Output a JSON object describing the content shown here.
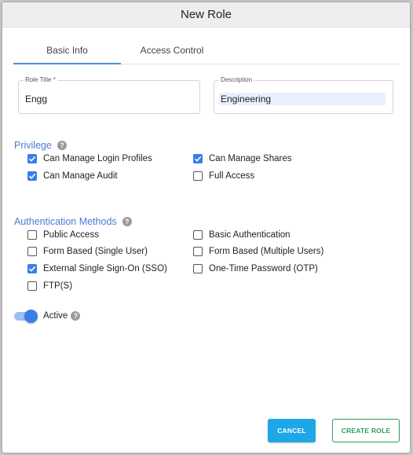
{
  "dialog": {
    "title": "New Role"
  },
  "tabs": [
    {
      "label": "Basic Info",
      "active": true
    },
    {
      "label": "Access Control",
      "active": false
    }
  ],
  "fields": {
    "role_title": {
      "label": "Role Title *",
      "value": "Engg"
    },
    "description": {
      "label": "Description",
      "value": "Engineering"
    }
  },
  "privilege": {
    "title": "Privilege",
    "help_icon": "help-icon",
    "items": [
      {
        "label": "Can Manage Login Profiles",
        "checked": true
      },
      {
        "label": "Can Manage Shares",
        "checked": true
      },
      {
        "label": "Can Manage Audit",
        "checked": true
      },
      {
        "label": "Full Access",
        "checked": false
      }
    ]
  },
  "auth": {
    "title": "Authentication Methods",
    "help_icon": "help-icon",
    "items": [
      {
        "label": "Public Access",
        "checked": false
      },
      {
        "label": "Basic Authentication",
        "checked": false
      },
      {
        "label": "Form Based (Single User)",
        "checked": false
      },
      {
        "label": "Form Based (Multiple Users)",
        "checked": false
      },
      {
        "label": "External Single Sign-On (SSO)",
        "checked": true
      },
      {
        "label": "One-Time Password (OTP)",
        "checked": false
      },
      {
        "label": "FTP(S)",
        "checked": false
      }
    ]
  },
  "active_toggle": {
    "label": "Active",
    "on": true
  },
  "help_glyph": "?",
  "buttons": {
    "cancel": "CANCEL",
    "create": "CREATE ROLE"
  },
  "colors": {
    "accent": "#3b7de9",
    "section_title": "#4a7bd4",
    "cancel_bg": "#1ea7e6",
    "create_border": "#2e9e5a"
  }
}
